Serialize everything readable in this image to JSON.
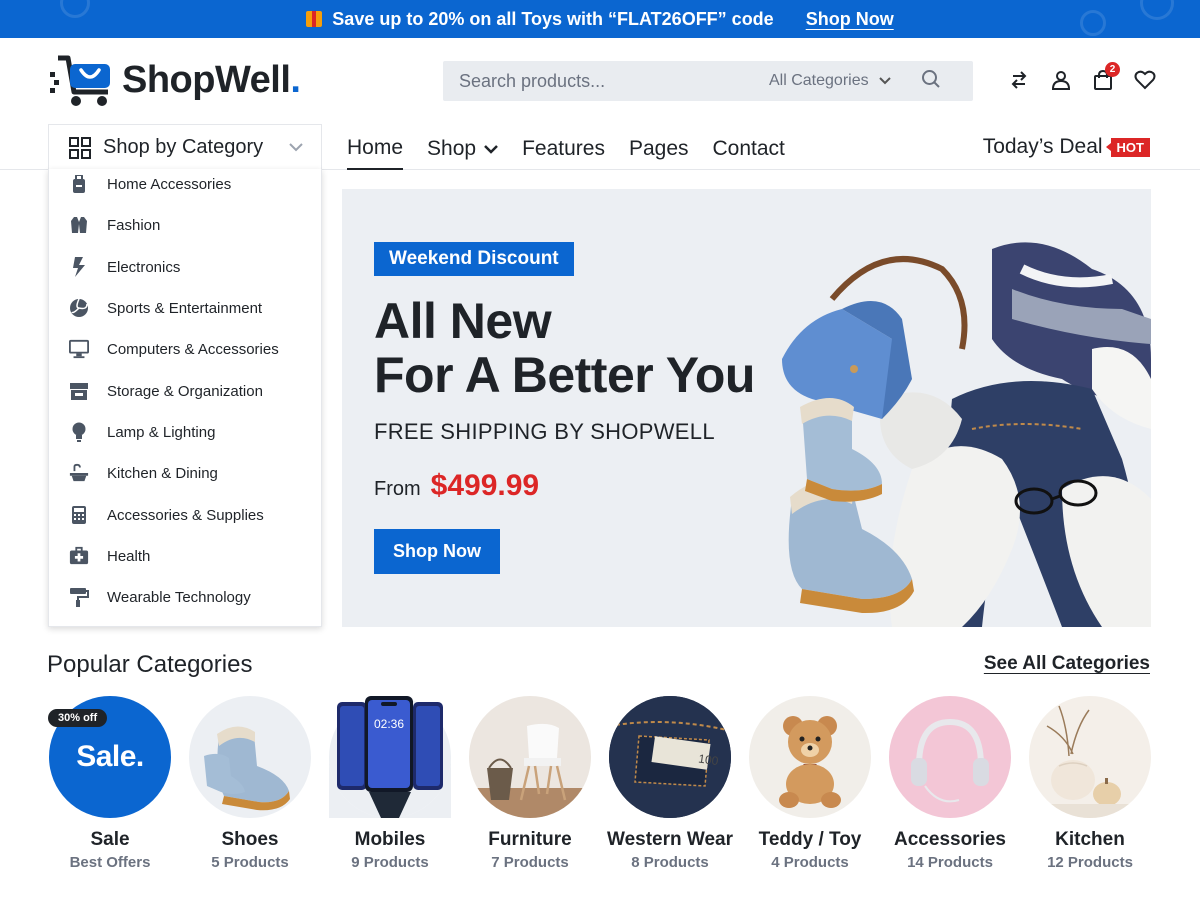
{
  "promo": {
    "text": "Save up to 20% on all Toys with “FLAT26OFF” code",
    "link": "Shop Now"
  },
  "logo": {
    "name": "ShopWell",
    "dot": "."
  },
  "search": {
    "placeholder": "Search products...",
    "category": "All Categories"
  },
  "cart": {
    "count": "2"
  },
  "category_button": "Shop by Category",
  "nav": {
    "home": "Home",
    "shop": "Shop",
    "features": "Features",
    "pages": "Pages",
    "contact": "Contact"
  },
  "deal": {
    "label": "Today’s Deal",
    "badge": "HOT"
  },
  "categories_menu": [
    {
      "label": "Home Accessories",
      "icon": "bag-icon"
    },
    {
      "label": "Fashion",
      "icon": "vest-icon"
    },
    {
      "label": "Electronics",
      "icon": "bolt-icon"
    },
    {
      "label": "Sports & Entertainment",
      "icon": "volleyball-icon"
    },
    {
      "label": "Computers & Accessories",
      "icon": "monitor-icon"
    },
    {
      "label": "Storage & Organization",
      "icon": "store-icon"
    },
    {
      "label": "Lamp & Lighting",
      "icon": "bulb-icon"
    },
    {
      "label": "Kitchen & Dining",
      "icon": "sink-icon"
    },
    {
      "label": "Accessories & Supplies",
      "icon": "calculator-icon"
    },
    {
      "label": "Health",
      "icon": "medkit-icon"
    },
    {
      "label": "Wearable Technology",
      "icon": "paint-roller-icon"
    }
  ],
  "hero": {
    "badge": "Weekend Discount",
    "line1": "All New",
    "line2": "For A Better You",
    "subtitle": "FREE SHIPPING BY SHOPWELL",
    "from": "From",
    "price": "$499.99",
    "button": "Shop Now"
  },
  "popular": {
    "title": "Popular Categories",
    "see_all": "See All Categories",
    "items": [
      {
        "name": "Sale",
        "count": "Best Offers",
        "circle_text": "Sale.",
        "tag": "30% off"
      },
      {
        "name": "Shoes",
        "count": "5 Products"
      },
      {
        "name": "Mobiles",
        "count": "9 Products",
        "phone_time": "02:36"
      },
      {
        "name": "Furniture",
        "count": "7 Products"
      },
      {
        "name": "Western Wear",
        "count": "8 Products"
      },
      {
        "name": "Teddy / Toy",
        "count": "4 Products"
      },
      {
        "name": "Accessories",
        "count": "14 Products"
      },
      {
        "name": "Kitchen",
        "count": "12 Products"
      }
    ]
  },
  "colors": {
    "brand": "#0b66d0",
    "accent_red": "#dc2626",
    "text": "#1f2328",
    "muted": "#6b7280",
    "hero_bg": "#eceff3"
  }
}
